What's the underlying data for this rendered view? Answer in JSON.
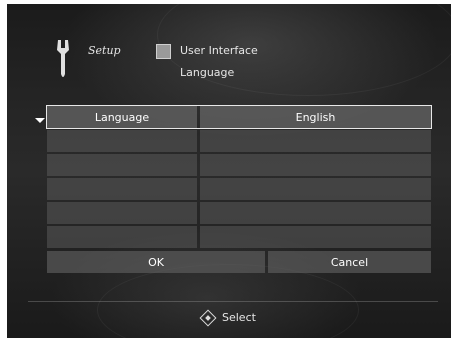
{
  "header": {
    "setup_label": "Setup",
    "section_label": "User Interface",
    "subsection_label": "Language",
    "icons": [
      "wrench-icon",
      "user-interface-icon"
    ]
  },
  "settings_table": {
    "rows": [
      {
        "label": "Language",
        "value": "English",
        "selected": true
      },
      {
        "label": "",
        "value": ""
      },
      {
        "label": "",
        "value": ""
      },
      {
        "label": "",
        "value": ""
      },
      {
        "label": "",
        "value": ""
      },
      {
        "label": "",
        "value": ""
      }
    ]
  },
  "buttons": {
    "ok_label": "OK",
    "cancel_label": "Cancel"
  },
  "footer": {
    "select_label": "Select",
    "select_icon": "dpad-icon"
  }
}
